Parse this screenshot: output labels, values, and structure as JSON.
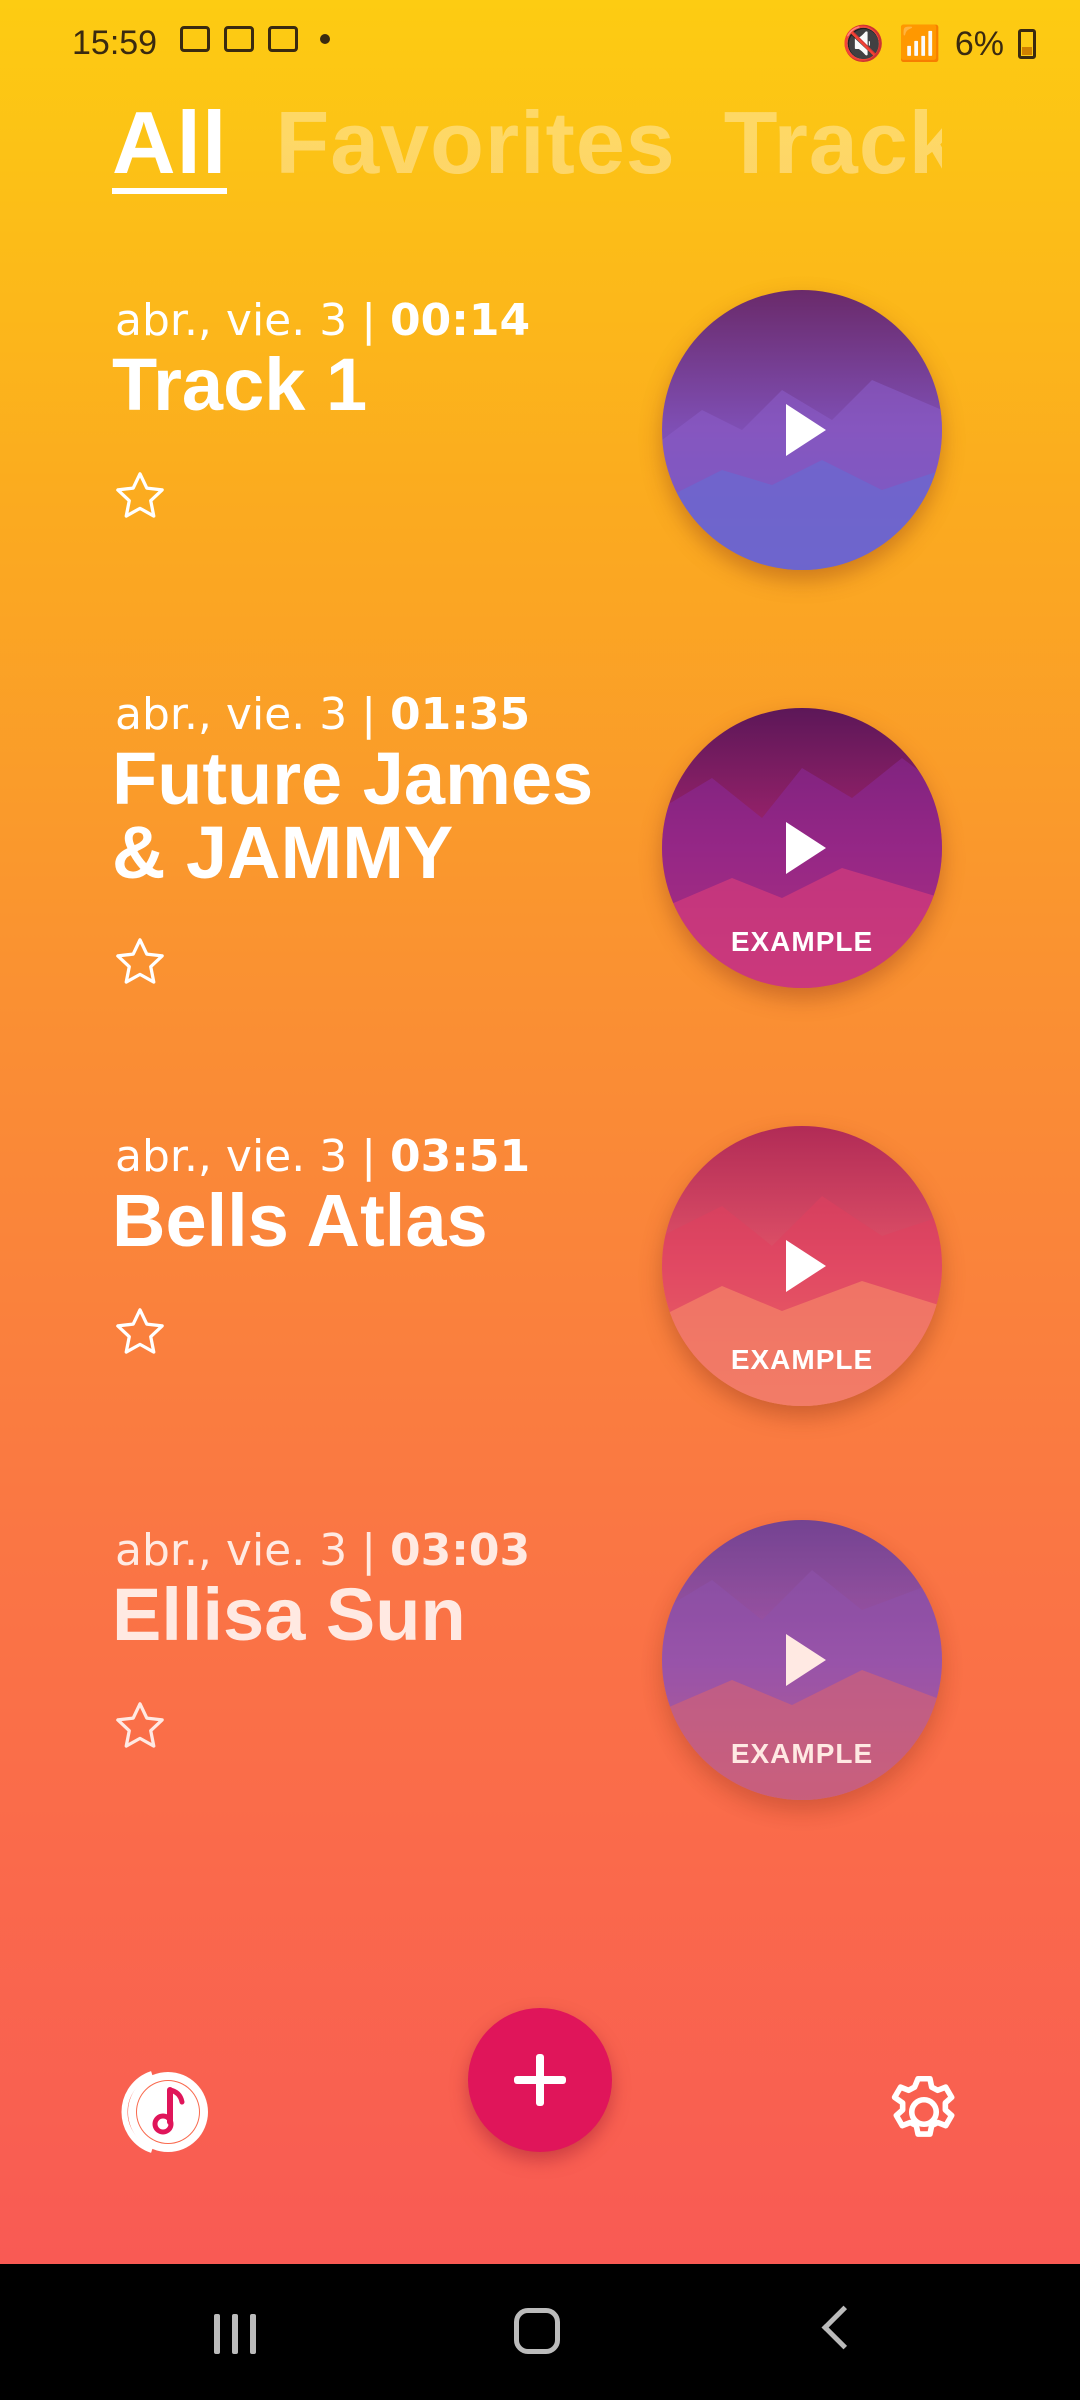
{
  "status": {
    "time": "15:59",
    "battery": "6%"
  },
  "tabs": [
    {
      "label": "All",
      "active": true
    },
    {
      "label": "Favorites",
      "active": false
    },
    {
      "label": "Tracks",
      "active": false
    }
  ],
  "tracks": [
    {
      "date": "abr., vie. 3 | ",
      "duration": "00:14",
      "title": "Track 1",
      "tag": "",
      "favorite": false,
      "colors": [
        "#6a2a6a",
        "#7f4fb5",
        "#5a5bc4"
      ]
    },
    {
      "date": "abr., vie. 3 | ",
      "duration": "01:35",
      "title": "Future James & JAMMY",
      "tag": "EXAMPLE",
      "favorite": false,
      "colors": [
        "#5c1758",
        "#a2246d",
        "#d8385a"
      ]
    },
    {
      "date": "abr., vie. 3 | ",
      "duration": "03:51",
      "title": "Bells Atlas",
      "tag": "EXAMPLE",
      "favorite": false,
      "colors": [
        "#b12b56",
        "#e25368",
        "#f79a6a"
      ]
    },
    {
      "date": "abr., vie. 3 | ",
      "duration": "03:03",
      "title": "Ellisa Sun",
      "tag": "EXAMPLE",
      "favorite": false,
      "colors": [
        "#5b3aa0",
        "#9452b8",
        "#e06a70"
      ]
    }
  ],
  "icons": {
    "logo": "music-note-logo-icon",
    "add": "plus-icon",
    "settings": "gear-icon",
    "favorite": "star-outline-icon",
    "play": "play-icon"
  }
}
